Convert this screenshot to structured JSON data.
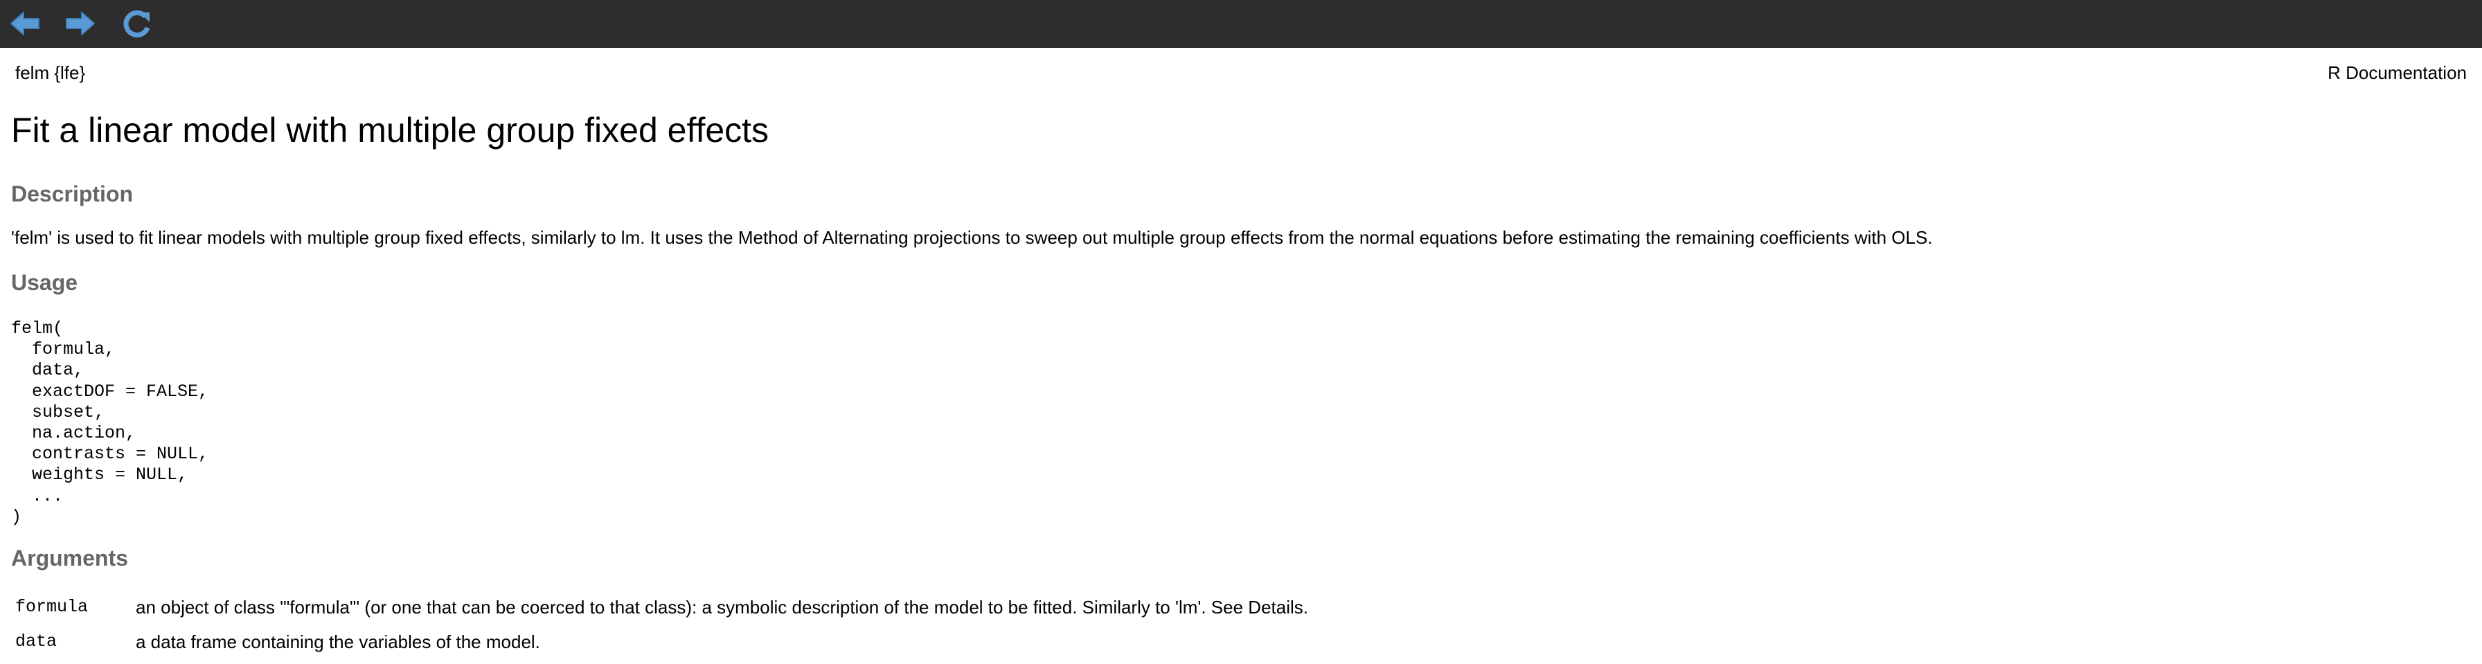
{
  "toolbar": {
    "back_icon": "arrow-left-icon",
    "forward_icon": "arrow-right-icon",
    "refresh_icon": "refresh-icon",
    "icon_color": "#5b9bd5"
  },
  "header": {
    "topic": "felm {lfe}",
    "source": "R Documentation"
  },
  "title": "Fit a linear model with multiple group fixed effects",
  "sections": {
    "description_heading": "Description",
    "description_text": "'felm' is used to fit linear models with multiple group fixed effects, similarly to lm. It uses the Method of Alternating projections to sweep out multiple group effects from the normal equations before estimating the remaining coefficients with OLS.",
    "usage_heading": "Usage",
    "usage_code": "felm(\n  formula,\n  data,\n  exactDOF = FALSE,\n  subset,\n  na.action,\n  contrasts = NULL,\n  weights = NULL,\n  ...\n)",
    "arguments_heading": "Arguments"
  },
  "arguments": [
    {
      "name": "formula",
      "description": "an object of class '\"formula\"' (or one that can be coerced to that class): a symbolic description of the model to be fitted. Similarly to 'lm'. See Details."
    },
    {
      "name": "data",
      "description": "a data frame containing the variables of the model."
    }
  ],
  "colors": {
    "toolbar_bg": "#2d2d2d",
    "heading_gray": "#666666"
  }
}
